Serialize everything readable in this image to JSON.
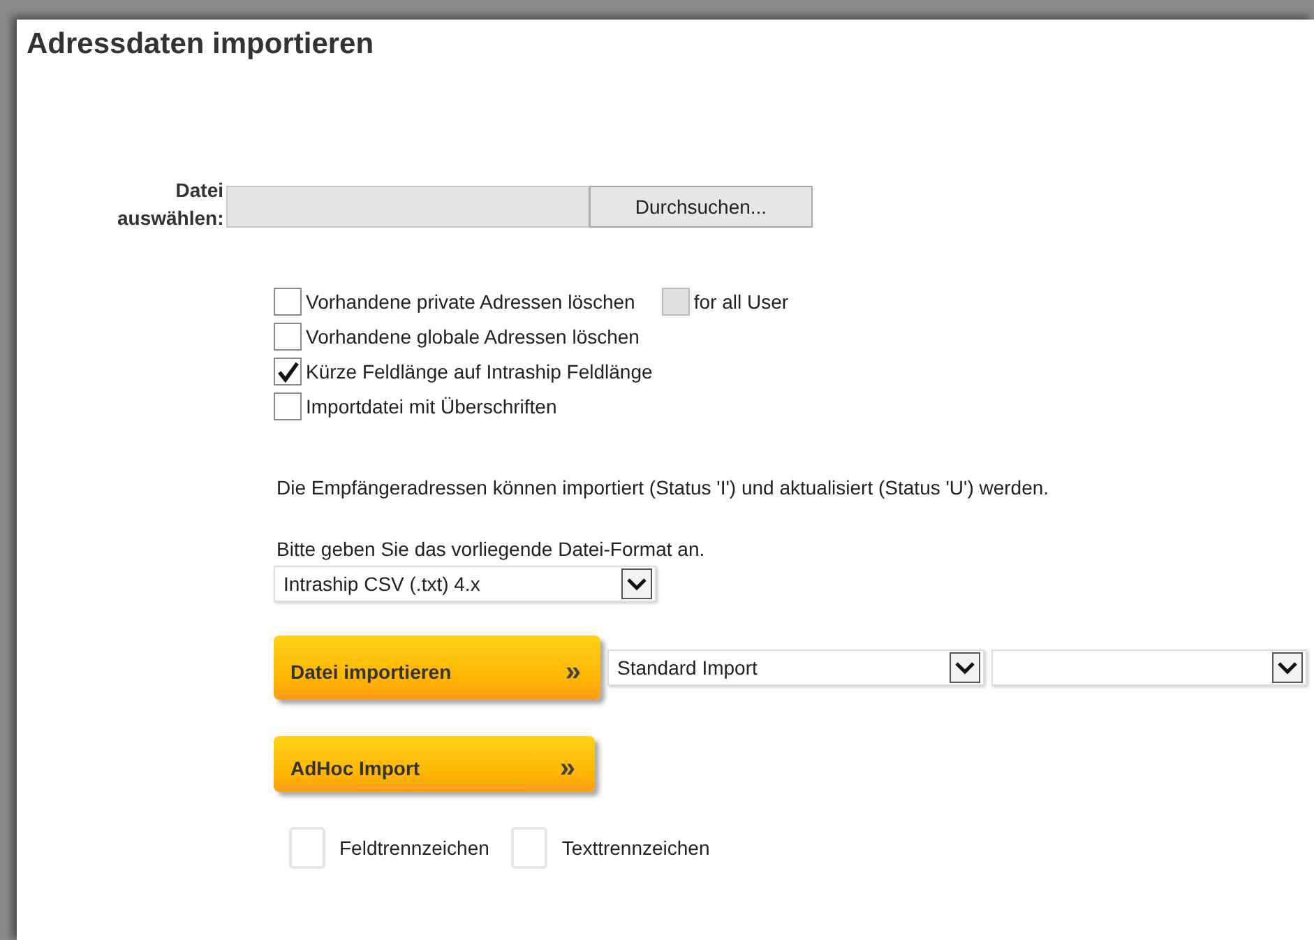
{
  "window": {
    "title": "Adressdaten importieren"
  },
  "file": {
    "label_lines": [
      "Datei",
      "auswählen:"
    ],
    "browse_button": "Durchsuchen..."
  },
  "options": [
    {
      "label": "Vorhandene private Adressen löschen",
      "checked": false,
      "extra": {
        "label": "for all User",
        "checked": false,
        "disabled": true
      }
    },
    {
      "label": "Vorhandene globale Adressen löschen",
      "checked": false
    },
    {
      "label": "Kürze Feldlänge auf Intraship Feldlänge",
      "checked": true
    },
    {
      "label": "Importdatei mit Überschriften",
      "checked": false
    }
  ],
  "info": "Die Empfängeradressen können importiert (Status 'I') und aktualisiert (Status 'U') werden.",
  "format": {
    "label": "Bitte geben Sie das vorliegende Datei-Format an.",
    "value": "Intraship CSV (.txt) 4.x"
  },
  "import_button": {
    "label": "Datei importieren",
    "arrow": "»"
  },
  "import_select": {
    "value": "Standard Import"
  },
  "adhoc_button": {
    "label": "AdHoc Import",
    "arrow": "»"
  },
  "separators": [
    {
      "label": "Feldtrennzeichen"
    },
    {
      "label": "Texttrennzeichen"
    }
  ]
}
